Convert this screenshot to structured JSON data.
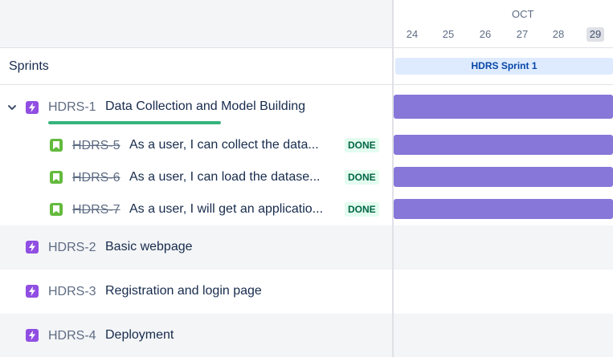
{
  "timeline": {
    "month": "OCT",
    "days": [
      "24",
      "25",
      "26",
      "27",
      "28",
      "29"
    ],
    "today": "29"
  },
  "sprints": {
    "label": "Sprints",
    "sprint_name": "HDRS Sprint 1"
  },
  "epics": [
    {
      "key": "HDRS-1",
      "summary": "Data Collection and Model Building",
      "expanded": true,
      "progress": 1.0,
      "children": [
        {
          "key": "HDRS-5",
          "summary": "As a user, I can collect the data...",
          "status": "DONE"
        },
        {
          "key": "HDRS-6",
          "summary": "As a user, I can load the datase...",
          "status": "DONE"
        },
        {
          "key": "HDRS-7",
          "summary": "As a user, I will get an applicatio...",
          "status": "DONE"
        }
      ]
    },
    {
      "key": "HDRS-2",
      "summary": "Basic webpage"
    },
    {
      "key": "HDRS-3",
      "summary": "Registration and login page"
    },
    {
      "key": "HDRS-4",
      "summary": "Deployment"
    }
  ],
  "colors": {
    "epic": "#904ee2",
    "story": "#63ba3c",
    "timeline_bar": "#8777d9",
    "done_lozenge_bg": "#e3fcef",
    "done_lozenge_text": "#006644",
    "progress": "#36b37e"
  },
  "icons": {
    "expand": "chevron-down-icon",
    "epic": "lightning-icon",
    "story": "bookmark-icon"
  }
}
